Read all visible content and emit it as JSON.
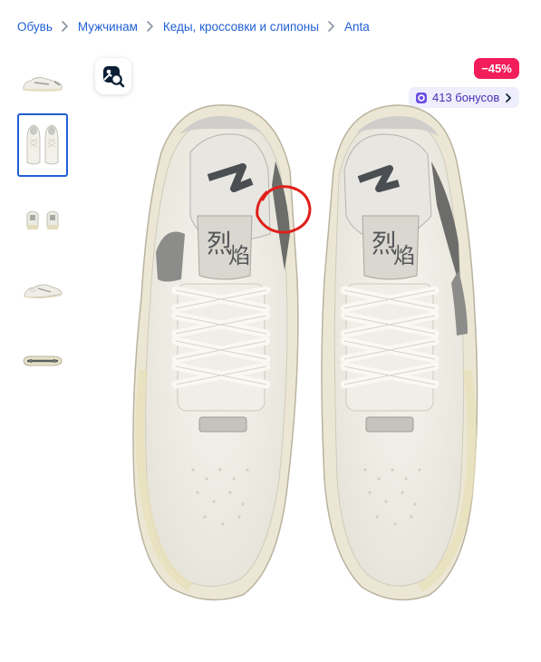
{
  "breadcrumb": {
    "items": [
      "Обувь",
      "Мужчинам",
      "Кеды, кроссовки и слипоны",
      "Anta"
    ]
  },
  "gallery": {
    "thumbnails": [
      {
        "view": "side"
      },
      {
        "view": "top",
        "selected": true
      },
      {
        "view": "back"
      },
      {
        "view": "side-angle"
      },
      {
        "view": "sole"
      }
    ],
    "main_image": "sneakers-top-view"
  },
  "search_by_photo": {
    "icon": "image-search-icon"
  },
  "discount_badge": {
    "label": "−45%",
    "color": "#f21d5b"
  },
  "bonus_badge": {
    "label": "413 бонусов",
    "icon": "bonus-coin-icon",
    "color": "#4a2fb5"
  },
  "colors": {
    "link": "#1f5fd6",
    "accent": "#f21d5b",
    "bonus_bg": "#efeefc"
  }
}
